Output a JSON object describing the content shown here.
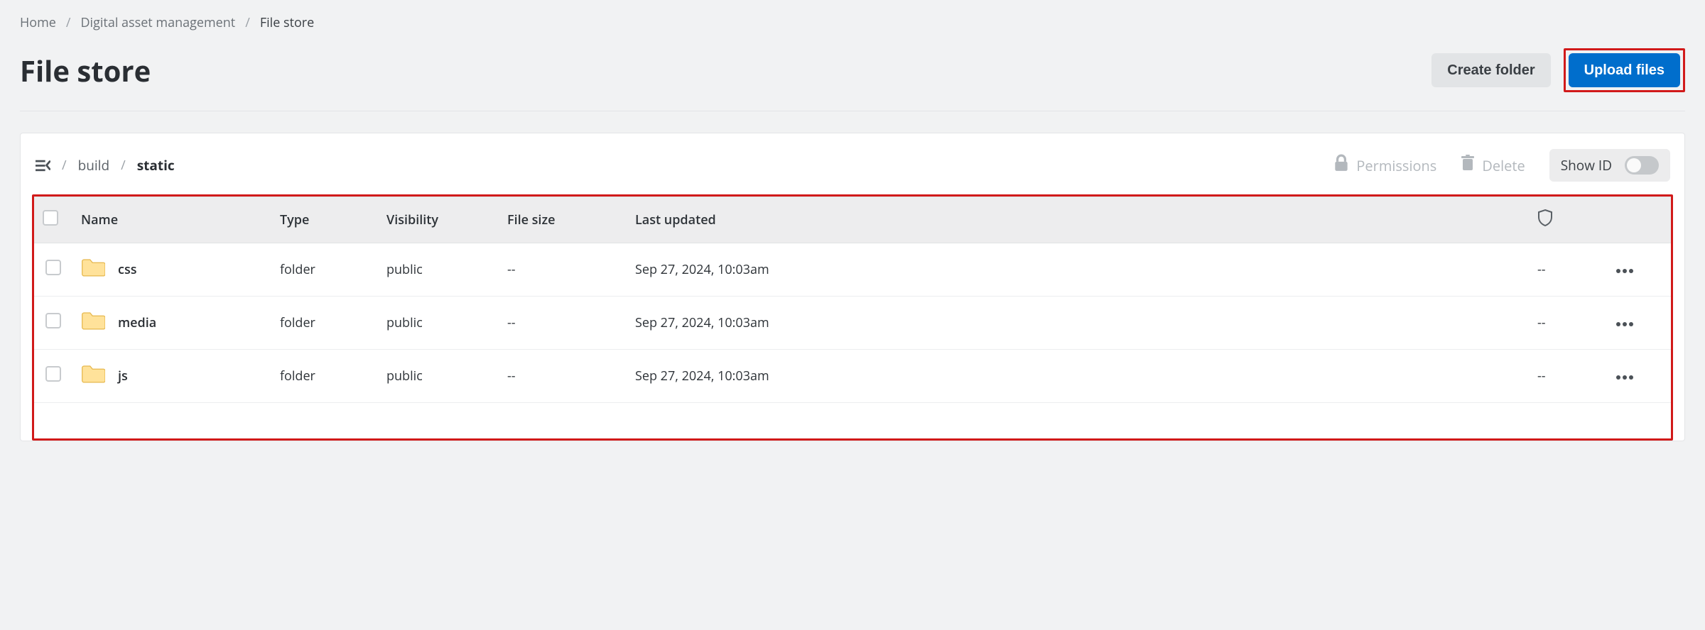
{
  "breadcrumb": {
    "home": "Home",
    "dam": "Digital asset management",
    "current": "File store"
  },
  "page": {
    "title": "File store",
    "create_folder": "Create folder",
    "upload_files": "Upload files"
  },
  "toolbar": {
    "path_part1": "build",
    "path_part2": "static",
    "permissions": "Permissions",
    "delete": "Delete",
    "show_id": "Show ID"
  },
  "table": {
    "headers": {
      "name": "Name",
      "type": "Type",
      "visibility": "Visibility",
      "size": "File size",
      "updated": "Last updated"
    },
    "rows": [
      {
        "name": "css",
        "type": "folder",
        "visibility": "public",
        "size": "--",
        "updated": "Sep 27, 2024, 10:03am",
        "perm": "--"
      },
      {
        "name": "media",
        "type": "folder",
        "visibility": "public",
        "size": "--",
        "updated": "Sep 27, 2024, 10:03am",
        "perm": "--"
      },
      {
        "name": "js",
        "type": "folder",
        "visibility": "public",
        "size": "--",
        "updated": "Sep 27, 2024, 10:03am",
        "perm": "--"
      }
    ]
  }
}
